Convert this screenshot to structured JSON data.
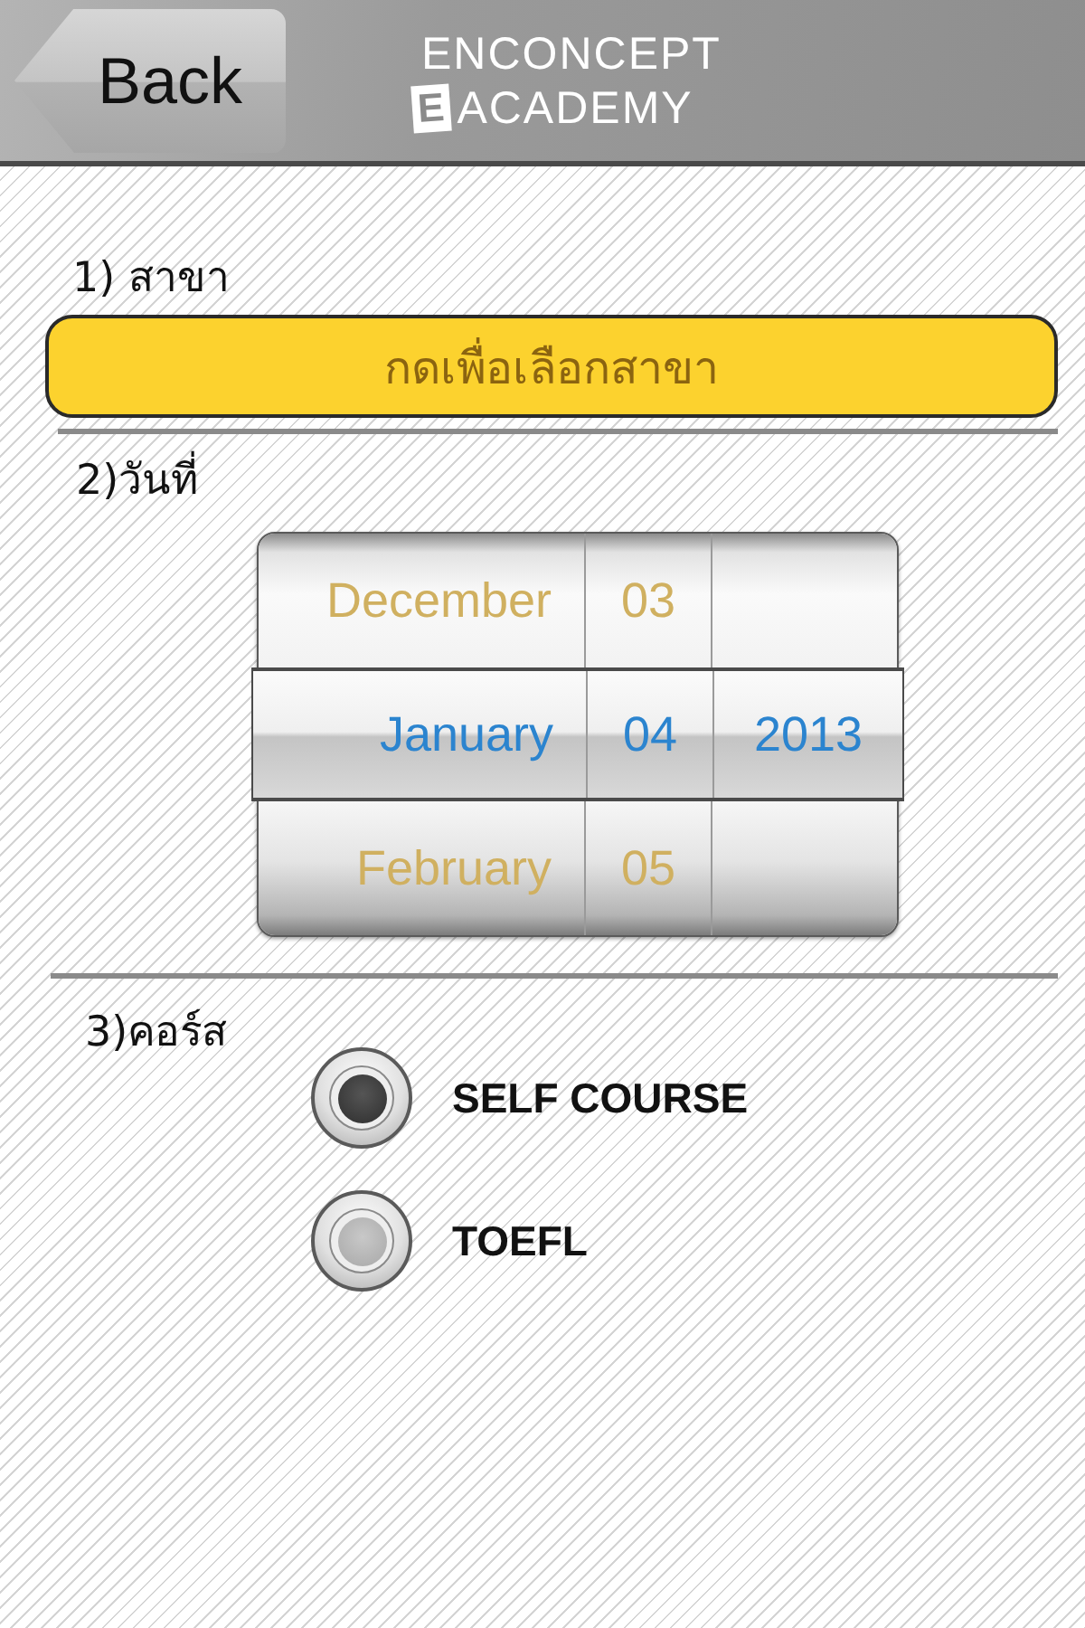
{
  "header": {
    "back_button": "Back",
    "logo": {
      "line_1": "ENCONCEPT",
      "badge_letter": "E",
      "line_2": "ACADEMY"
    }
  },
  "sections": [
    {
      "kind": "dropdown",
      "label": "1) สาขา",
      "button": "กดเพื่อเลือกสาขา"
    },
    {
      "kind": "date_picker",
      "label": "2)วันที่",
      "rows": [
        {
          "selected": false,
          "cells": [
            "December",
            "03"
          ]
        },
        {
          "selected": true,
          "cells": [
            "January",
            "04",
            "2013"
          ]
        },
        {
          "selected": false,
          "cells": [
            "February",
            "05"
          ]
        }
      ]
    },
    {
      "kind": "radio_group",
      "label": "3)คอร์ส",
      "options": [
        {
          "label": "SELF COURSE",
          "selected": true
        },
        {
          "label": "TOEFL",
          "selected": false
        }
      ]
    }
  ]
}
